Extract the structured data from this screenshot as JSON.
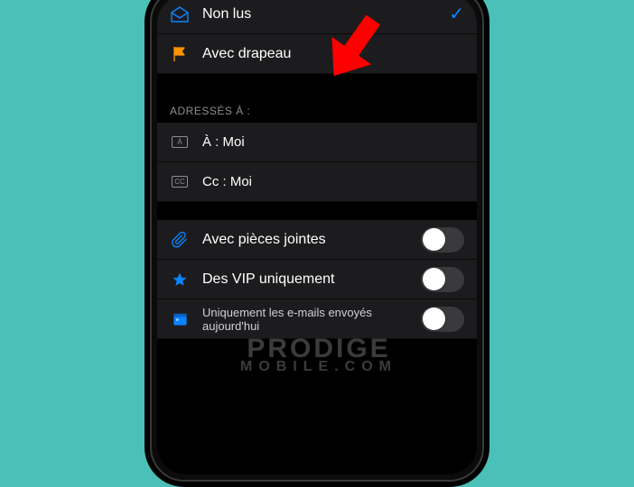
{
  "filters1": {
    "unread": {
      "label": "Non lus",
      "checked": true
    },
    "flagged": {
      "label": "Avec drapeau"
    }
  },
  "addressed": {
    "header": "Adressés à :",
    "to": {
      "badge": "À",
      "label": "À : Moi"
    },
    "cc": {
      "badge": "CC",
      "label": "Cc : Moi"
    }
  },
  "filters2": {
    "attachments": {
      "label": "Avec pièces jointes",
      "on": false
    },
    "vip": {
      "label": "Des VIP uniquement",
      "on": false
    },
    "today": {
      "label": "Uniquement les e-mails envoyés aujourd'hui",
      "on": false
    }
  },
  "watermark": {
    "line1": "PRODIGE",
    "line2": "MOBILE.COM"
  }
}
